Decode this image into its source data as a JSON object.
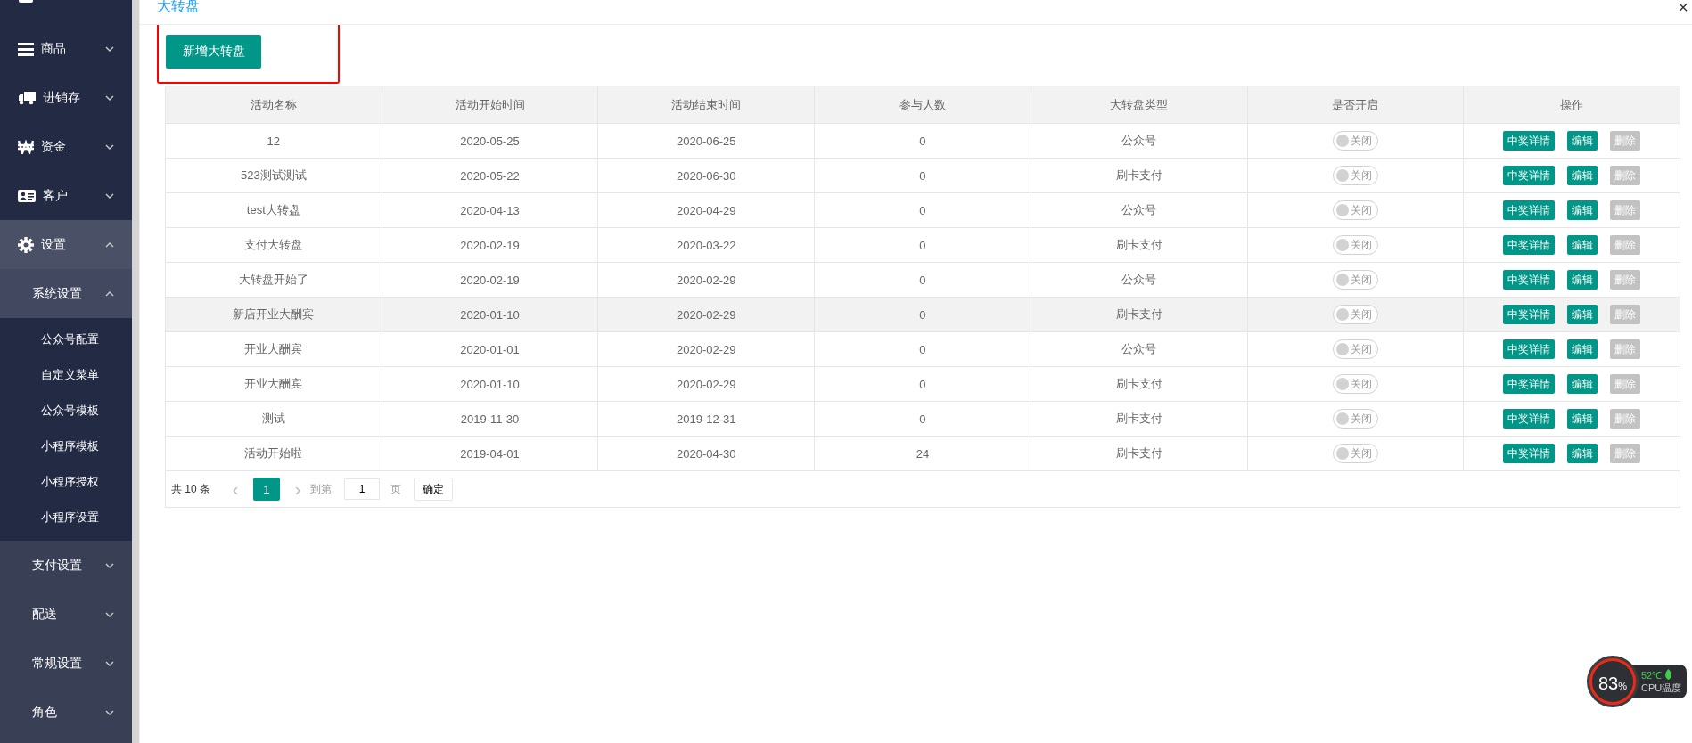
{
  "sidebar": {
    "items": [
      {
        "selected": false
      },
      {
        "label": "商品",
        "expanded": false,
        "selected": false
      },
      {
        "label": "进销存",
        "expanded": false,
        "selected": false
      },
      {
        "label": "资金",
        "expanded": false,
        "selected": false
      },
      {
        "label": "客户",
        "expanded": false,
        "selected": false
      },
      {
        "label": "设置",
        "expanded": true,
        "selected": true,
        "children": [
          {
            "label": "系统设置",
            "expanded": true,
            "children": [
              {
                "label": "公众号配置",
                "selected": false
              },
              {
                "label": "自定义菜单",
                "selected": false
              },
              {
                "label": "公众号模板",
                "selected": false
              },
              {
                "label": "小程序模板",
                "selected": false
              },
              {
                "label": "小程序授权",
                "selected": false
              },
              {
                "label": "小程序设置",
                "selected": false
              }
            ]
          },
          {
            "label": "支付设置",
            "expanded": false
          },
          {
            "label": "配送",
            "expanded": false
          },
          {
            "label": "常规设置",
            "expanded": false
          },
          {
            "label": "角色",
            "expanded": false
          }
        ]
      }
    ]
  },
  "page": {
    "title": "大转盘",
    "close": "×",
    "add_button": "新增大转盘"
  },
  "table": {
    "columns": [
      "活动名称",
      "活动开始时间",
      "活动结束时间",
      "参与人数",
      "大转盘类型",
      "是否开启",
      "操作"
    ],
    "rows": [
      {
        "cells": [
          "12",
          "2020-05-25",
          "2020-06-25",
          "0",
          "公众号"
        ],
        "toggle": {
          "on": false,
          "label": "关闭"
        },
        "highlighted": false,
        "actions": [
          {
            "label": "中奖详情",
            "disabled": false
          },
          {
            "label": "编辑",
            "disabled": false
          },
          {
            "label": "删除",
            "disabled": true
          }
        ]
      },
      {
        "cells": [
          "523测试测试",
          "2020-05-22",
          "2020-06-30",
          "0",
          "刷卡支付"
        ],
        "toggle": {
          "on": false,
          "label": "关闭"
        },
        "highlighted": false,
        "actions": [
          {
            "label": "中奖详情",
            "disabled": false
          },
          {
            "label": "编辑",
            "disabled": false
          },
          {
            "label": "删除",
            "disabled": true
          }
        ]
      },
      {
        "cells": [
          "test大转盘",
          "2020-04-13",
          "2020-04-29",
          "0",
          "公众号"
        ],
        "toggle": {
          "on": false,
          "label": "关闭"
        },
        "highlighted": false,
        "actions": [
          {
            "label": "中奖详情",
            "disabled": false
          },
          {
            "label": "编辑",
            "disabled": false
          },
          {
            "label": "删除",
            "disabled": true
          }
        ]
      },
      {
        "cells": [
          "支付大转盘",
          "2020-02-19",
          "2020-03-22",
          "0",
          "刷卡支付"
        ],
        "toggle": {
          "on": false,
          "label": "关闭"
        },
        "highlighted": false,
        "actions": [
          {
            "label": "中奖详情",
            "disabled": false
          },
          {
            "label": "编辑",
            "disabled": false
          },
          {
            "label": "删除",
            "disabled": true
          }
        ]
      },
      {
        "cells": [
          "大转盘开始了",
          "2020-02-19",
          "2020-02-29",
          "0",
          "公众号"
        ],
        "toggle": {
          "on": false,
          "label": "关闭"
        },
        "highlighted": false,
        "actions": [
          {
            "label": "中奖详情",
            "disabled": false
          },
          {
            "label": "编辑",
            "disabled": false
          },
          {
            "label": "删除",
            "disabled": true
          }
        ]
      },
      {
        "cells": [
          "新店开业大酬宾",
          "2020-01-10",
          "2020-02-29",
          "0",
          "刷卡支付"
        ],
        "toggle": {
          "on": false,
          "label": "关闭"
        },
        "highlighted": true,
        "actions": [
          {
            "label": "中奖详情",
            "disabled": false
          },
          {
            "label": "编辑",
            "disabled": false
          },
          {
            "label": "删除",
            "disabled": true
          }
        ]
      },
      {
        "cells": [
          "开业大酬宾",
          "2020-01-01",
          "2020-02-29",
          "0",
          "公众号"
        ],
        "toggle": {
          "on": false,
          "label": "关闭"
        },
        "highlighted": false,
        "actions": [
          {
            "label": "中奖详情",
            "disabled": false
          },
          {
            "label": "编辑",
            "disabled": false
          },
          {
            "label": "删除",
            "disabled": true
          }
        ]
      },
      {
        "cells": [
          "开业大酬宾",
          "2020-01-10",
          "2020-02-29",
          "0",
          "刷卡支付"
        ],
        "toggle": {
          "on": false,
          "label": "关闭"
        },
        "highlighted": false,
        "actions": [
          {
            "label": "中奖详情",
            "disabled": false
          },
          {
            "label": "编辑",
            "disabled": false
          },
          {
            "label": "删除",
            "disabled": true
          }
        ]
      },
      {
        "cells": [
          "测试",
          "2019-11-30",
          "2019-12-31",
          "0",
          "刷卡支付"
        ],
        "toggle": {
          "on": false,
          "label": "关闭"
        },
        "highlighted": false,
        "actions": [
          {
            "label": "中奖详情",
            "disabled": false
          },
          {
            "label": "编辑",
            "disabled": false
          },
          {
            "label": "删除",
            "disabled": true
          }
        ]
      },
      {
        "cells": [
          "活动开始啦",
          "2019-04-01",
          "2020-04-30",
          "24",
          "刷卡支付"
        ],
        "toggle": {
          "on": false,
          "label": "关闭"
        },
        "highlighted": false,
        "actions": [
          {
            "label": "中奖详情",
            "disabled": false
          },
          {
            "label": "编辑",
            "disabled": false
          },
          {
            "label": "删除",
            "disabled": true
          }
        ]
      }
    ]
  },
  "pagination": {
    "total": "共 10 条",
    "prev": "‹",
    "pages": [
      {
        "label": "1",
        "selected": true
      }
    ],
    "next": "›",
    "goto_label": "到第",
    "goto_value": "1",
    "page_label": "页",
    "confirm": "确定"
  },
  "cpu_widget": {
    "usage": "83",
    "unit": "%",
    "temperature": "52℃",
    "label": "CPU温度"
  }
}
